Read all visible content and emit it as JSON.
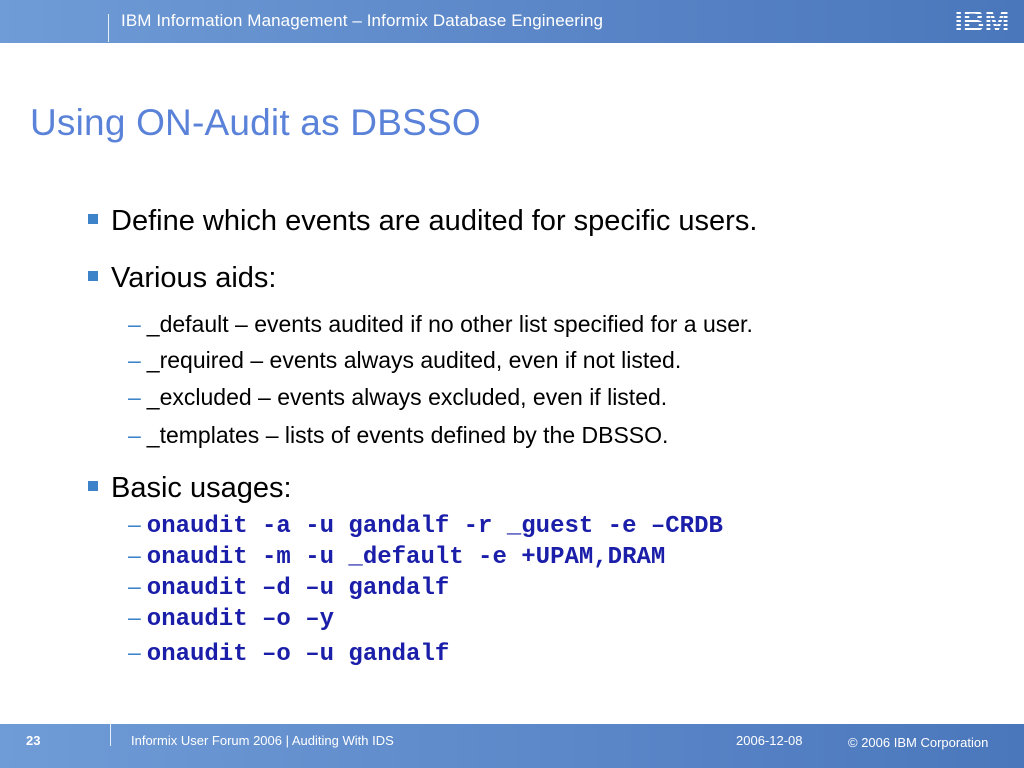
{
  "header": {
    "title": "IBM Information Management – Informix Database Engineering",
    "logo_text": "IBM"
  },
  "slide": {
    "title": "Using ON-Audit as DBSSO",
    "bullets": [
      {
        "text": "Define which events are audited for specific users."
      },
      {
        "text": "Various aids:",
        "sub": [
          "_default – events audited if no other list specified for a user.",
          "_required – events always audited, even if not listed.",
          "_excluded – events always excluded, even if listed.",
          "_templates – lists of events defined by the DBSSO."
        ]
      },
      {
        "text": "Basic usages:",
        "sub": [
          "onaudit -a -u gandalf -r _guest -e –CRDB",
          "onaudit -m -u _default -e +UPAM,DRAM",
          "onaudit –d –u gandalf",
          "onaudit –o –y",
          "onaudit –o –u gandalf"
        ]
      }
    ],
    "dash": "–"
  },
  "footer": {
    "page_number": "23",
    "text": "Informix User Forum 2006 | Auditing With IDS",
    "date": "2006-12-08",
    "copyright": "© 2006 IBM Corporation"
  },
  "colors": {
    "header_bar": "#5a86c8",
    "title": "#5a82d8",
    "bullet": "#3d83c9",
    "code": "#1a1ea8"
  }
}
